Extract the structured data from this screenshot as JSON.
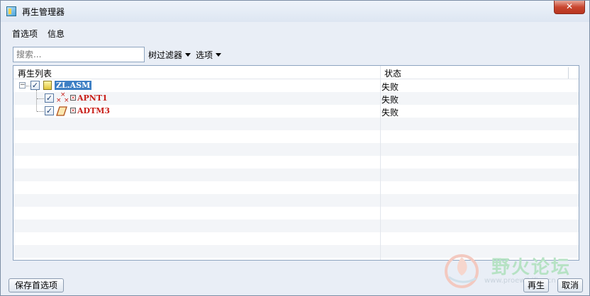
{
  "window": {
    "title": "再生管理器"
  },
  "menu": {
    "items": [
      "首选项",
      "信息"
    ]
  },
  "toolbar": {
    "search_placeholder": "搜索...",
    "tree_filter_label": "树过滤器",
    "options_label": "选项"
  },
  "table": {
    "columns": [
      "再生列表",
      "状态"
    ],
    "rows": [
      {
        "label": "ZL.ASM",
        "status": "失败",
        "level": 0,
        "checked": true,
        "icon": "assembly-icon"
      },
      {
        "label": "APNT1",
        "status": "失败",
        "level": 1,
        "checked": true,
        "icon": "datum-point-icon"
      },
      {
        "label": "ADTM3",
        "status": "失败",
        "level": 1,
        "checked": true,
        "icon": "datum-plane-icon"
      }
    ]
  },
  "buttons": {
    "save_prefs": "保存首选项",
    "regenerate": "再生",
    "cancel": "取消"
  },
  "watermark": {
    "text": "野火论坛",
    "url": "www.proewildfire.cn"
  },
  "colors": {
    "selection": "#3d7fc4",
    "error_text": "#c8201a",
    "close_button": "#c9462f"
  }
}
